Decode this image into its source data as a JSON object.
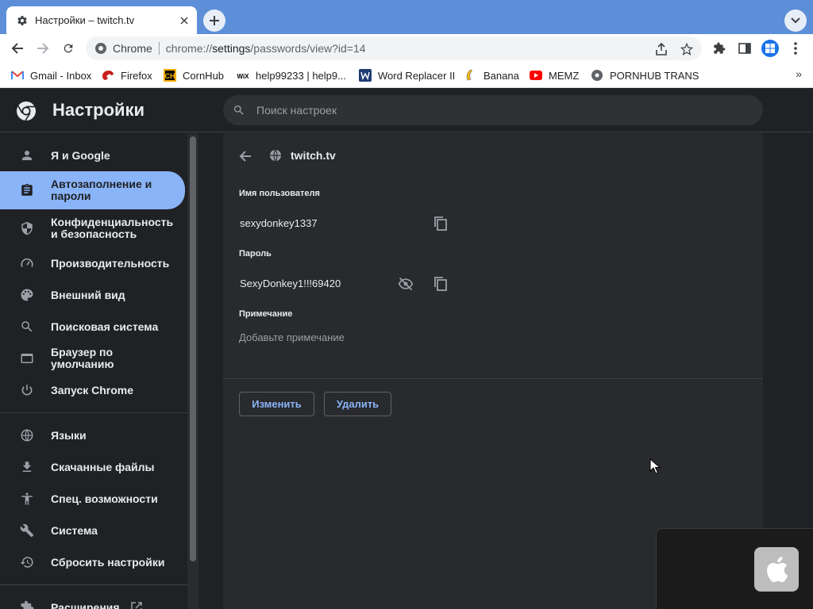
{
  "browser": {
    "tab": {
      "title": "Настройки – twitch.tv"
    },
    "omnibox": {
      "chip": "Chrome",
      "url_prefix": "chrome://",
      "url_host": "settings",
      "url_path": "/passwords/view?id=14"
    },
    "bookmarks": [
      {
        "label": "Gmail - Inbox",
        "icon": "gmail-icon"
      },
      {
        "label": "Firefox",
        "icon": "firefox-icon"
      },
      {
        "label": "CornHub",
        "icon": "cornhub-icon"
      },
      {
        "label": "help99233 | help9...",
        "icon": "wix-icon"
      },
      {
        "label": "Word Replacer II",
        "icon": "word-replacer-icon"
      },
      {
        "label": "Banana",
        "icon": "banana-icon"
      },
      {
        "label": "MEMZ",
        "icon": "youtube-icon"
      },
      {
        "label": "PORNHUB TRANS",
        "icon": "globe-icon"
      }
    ],
    "bookmarks_overflow": "»"
  },
  "settings": {
    "title": "Настройки",
    "search_placeholder": "Поиск настроек",
    "nav": [
      {
        "label": "Я и Google",
        "icon": "person-icon"
      },
      {
        "label": "Автозаполнение и пароли",
        "icon": "clipboard-icon"
      },
      {
        "label": "Конфиденциальность и безопасность",
        "icon": "shield-icon"
      },
      {
        "label": "Производительность",
        "icon": "speedometer-icon"
      },
      {
        "label": "Внешний вид",
        "icon": "palette-icon"
      },
      {
        "label": "Поисковая система",
        "icon": "search-icon"
      },
      {
        "label": "Браузер по умолчанию",
        "icon": "browser-icon"
      },
      {
        "label": "Запуск Chrome",
        "icon": "power-icon"
      },
      {
        "label": "Языки",
        "icon": "globe-icon"
      },
      {
        "label": "Скачанные файлы",
        "icon": "download-icon"
      },
      {
        "label": "Спец. возможности",
        "icon": "accessibility-icon"
      },
      {
        "label": "Система",
        "icon": "wrench-icon"
      },
      {
        "label": "Сбросить настройки",
        "icon": "restore-icon"
      },
      {
        "label": "Расширения",
        "icon": "puzzle-icon"
      }
    ],
    "active_nav": "Автозаполнение и пароли",
    "password_detail": {
      "site": "twitch.tv",
      "username_label": "Имя пользователя",
      "username": "sexydonkey1337",
      "password_label": "Пароль",
      "password": "SexyDonkey1!!!69420",
      "note_label": "Примечание",
      "note_placeholder": "Добавьте примечание",
      "edit_button": "Изменить",
      "delete_button": "Удалить"
    }
  },
  "colors": {
    "tabstrip": "#5c8fd8",
    "accent": "#8ab4f8",
    "background": "#202124",
    "card": "#292a2d"
  }
}
